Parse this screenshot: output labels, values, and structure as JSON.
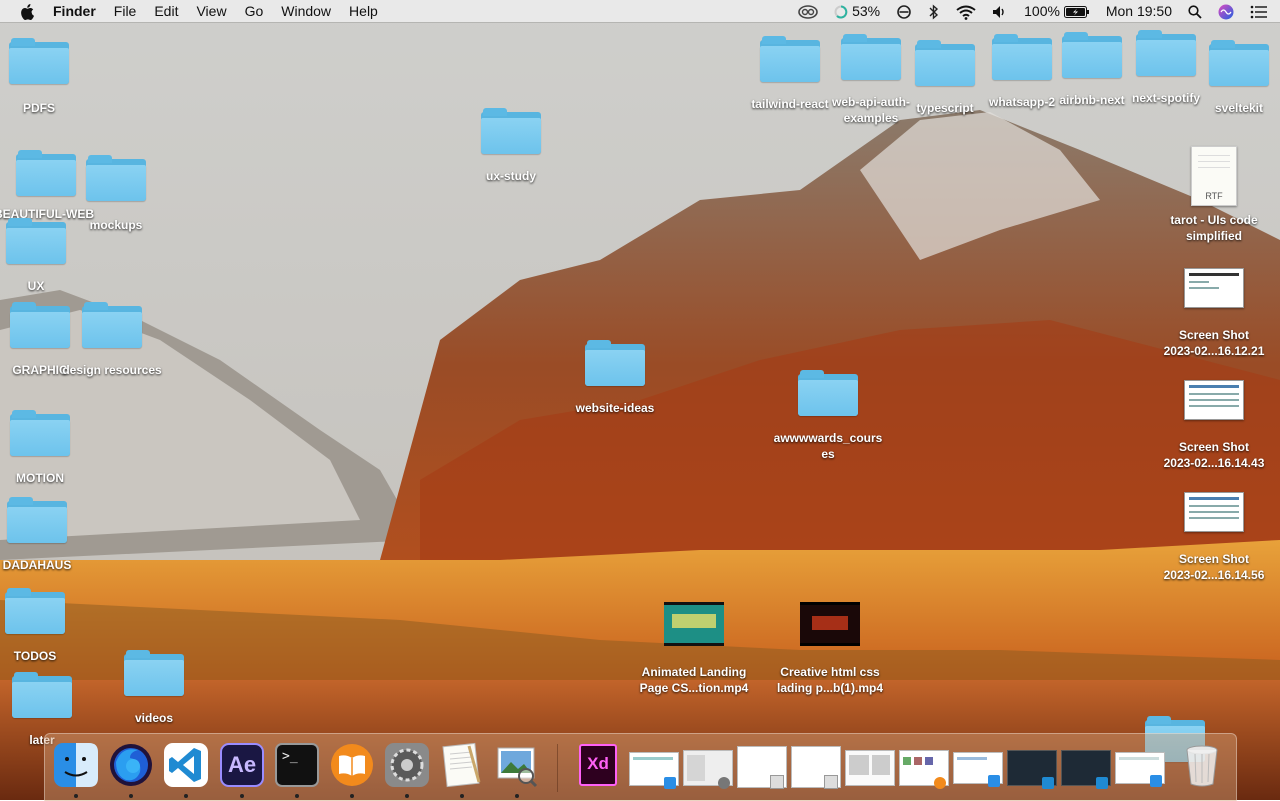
{
  "menubar": {
    "apple": "",
    "app_name": "Finder",
    "menus": [
      "File",
      "Edit",
      "View",
      "Go",
      "Window",
      "Help"
    ],
    "status": {
      "cpu_percent": "53%",
      "battery_percent": "100%",
      "clock": "Mon 19:50"
    }
  },
  "desktop": {
    "folders": [
      {
        "label": "PDFS"
      },
      {
        "label": "BEAUTIFUL-WEB"
      },
      {
        "label": "mockups"
      },
      {
        "label": "UX"
      },
      {
        "label": "GRAPHIC"
      },
      {
        "label": "design resources"
      },
      {
        "label": "MOTION"
      },
      {
        "label": "DADAHAUS"
      },
      {
        "label": "TODOS"
      },
      {
        "label": "videos"
      },
      {
        "label": "later"
      },
      {
        "label": "ux-study"
      },
      {
        "label": "website-ideas"
      },
      {
        "label": "awwwwards_courses_line1",
        "text": "awwwwards_cours"
      },
      {
        "label": "awwwwards_courses_line2",
        "text": "es"
      },
      {
        "label": "tailwind-react"
      },
      {
        "label": "web-api-auth-"
      },
      {
        "label": "examples"
      },
      {
        "label": "typescript"
      },
      {
        "label": "whatsapp-2"
      },
      {
        "label": "airbnb-next"
      },
      {
        "label": "next-spotify"
      },
      {
        "label": "sveltekit"
      }
    ],
    "files": {
      "rtf": {
        "badge": "RTF",
        "line1": "tarot - UIs code",
        "line2": "simplified"
      },
      "shot1": {
        "line1": "Screen Shot",
        "line2": "2023-02...16.12.21"
      },
      "shot2": {
        "line1": "Screen Shot",
        "line2": "2023-02...16.14.43"
      },
      "shot3": {
        "line1": "Screen Shot",
        "line2": "2023-02...16.14.56"
      },
      "video1": {
        "line1": "Animated Landing",
        "line2": "Page CS...tion.mp4"
      },
      "video2": {
        "line1": "Creative html css",
        "line2": "lading p...b(1).mp4"
      }
    }
  },
  "dock": {
    "apps": [
      "finder-icon",
      "firefox-icon",
      "vscode-icon",
      "after-effects-icon",
      "terminal-icon",
      "books-icon",
      "system-preferences-icon",
      "textedit-icon",
      "preview-icon"
    ],
    "ae_label": "Ae",
    "xd_label": "Xd",
    "terminal_label": ">_"
  },
  "colors": {
    "folder": "#6dc3ec",
    "menubar": "#ececec"
  }
}
